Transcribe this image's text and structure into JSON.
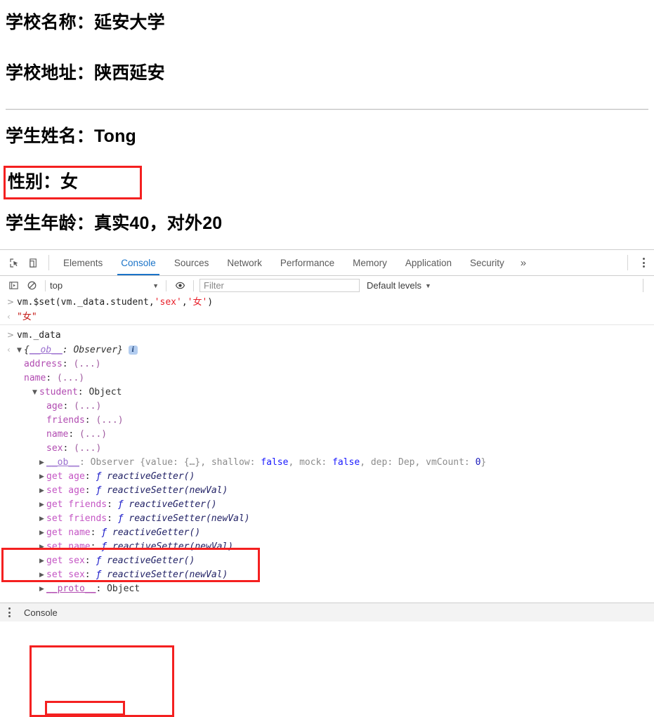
{
  "page": {
    "school_name_line": "学校名称：延安大学",
    "school_address_line": "学校地址：陕西延安",
    "student_name_line": "学生姓名：Tong",
    "student_sex_line": "性别：女",
    "student_age_line": "学生年龄：真实40，对外20"
  },
  "devtools": {
    "tabs": [
      {
        "label": "Elements",
        "active": false
      },
      {
        "label": "Console",
        "active": true
      },
      {
        "label": "Sources",
        "active": false
      },
      {
        "label": "Network",
        "active": false
      },
      {
        "label": "Performance",
        "active": false
      },
      {
        "label": "Memory",
        "active": false
      },
      {
        "label": "Application",
        "active": false
      },
      {
        "label": "Security",
        "active": false
      }
    ],
    "more_tabs_glyph": "»",
    "filterbar": {
      "context": "top",
      "context_caret": "▼",
      "filter_placeholder": "Filter",
      "levels_label": "Default levels",
      "levels_caret": "▼"
    },
    "statusbar": {
      "label": "Console"
    }
  },
  "console": {
    "command": {
      "prompt": ">",
      "pre": "vm.$set(vm._data.student,",
      "arg_sex": "'sex'",
      "comma": ",",
      "arg_value": "'女'",
      "post": ")"
    },
    "command_result": {
      "prompt": "‹",
      "value": "\"女\""
    },
    "command2": {
      "prompt": ">",
      "text": "vm._data"
    },
    "result2": {
      "prompt": "‹",
      "arrow": "▼",
      "brace_open": "{",
      "ob_key": "__ob__",
      "colon": ": ",
      "observer": "Observer",
      "brace_close": "}",
      "info_badge": "i"
    },
    "data_props": [
      {
        "key": "address",
        "value": "(...)"
      },
      {
        "key": "name",
        "value": "(...)"
      }
    ],
    "student_node": {
      "arrow": "▼",
      "key": "student",
      "colon": ": ",
      "type": "Object"
    },
    "student_props": [
      {
        "key": "age",
        "value": "(...)"
      },
      {
        "key": "friends",
        "value": "(...)"
      },
      {
        "key": "name",
        "value": "(...)"
      },
      {
        "key": "sex",
        "value": "(...)"
      }
    ],
    "ob_line": {
      "arrow": "▶",
      "key": "__ob__",
      "colon": ": ",
      "ctor": "Observer ",
      "brace_open": "{",
      "k_value": "value: ",
      "v_value": "{…}",
      "sep1": ", ",
      "k_shallow": "shallow: ",
      "v_shallow": "false",
      "sep2": ", ",
      "k_mock": "mock: ",
      "v_mock": "false",
      "sep3": ", ",
      "k_dep": "dep: ",
      "v_dep": "Dep",
      "sep4": ", ",
      "k_vmcount": "vmCount: ",
      "v_vmcount": "0",
      "brace_close": "}"
    },
    "accessors": [
      {
        "arrow": "▶",
        "kind": "get age",
        "fn_glyph": "ƒ",
        "fn": "reactiveGetter()"
      },
      {
        "arrow": "▶",
        "kind": "set age",
        "fn_glyph": "ƒ",
        "fn": "reactiveSetter(newVal)"
      },
      {
        "arrow": "▶",
        "kind": "get friends",
        "fn_glyph": "ƒ",
        "fn": "reactiveGetter()"
      },
      {
        "arrow": "▶",
        "kind": "set friends",
        "fn_glyph": "ƒ",
        "fn": "reactiveSetter(newVal)"
      },
      {
        "arrow": "▶",
        "kind": "get name",
        "fn_glyph": "ƒ",
        "fn": "reactiveGetter()"
      },
      {
        "arrow": "▶",
        "kind": "set name",
        "fn_glyph": "ƒ",
        "fn": "reactiveSetter(newVal)"
      },
      {
        "arrow": "▶",
        "kind": "get sex",
        "fn_glyph": "ƒ",
        "fn": "reactiveGetter()"
      },
      {
        "arrow": "▶",
        "kind": "set sex",
        "fn_glyph": "ƒ",
        "fn": "reactiveSetter(newVal)"
      }
    ],
    "proto_line": {
      "arrow": "▶",
      "key": "__proto__",
      "colon": ": ",
      "type": "Object"
    }
  },
  "annotations": {
    "highlight_color": "#f42020",
    "boxes": [
      "sex-display",
      "set-command",
      "student-object",
      "sex-property"
    ]
  }
}
